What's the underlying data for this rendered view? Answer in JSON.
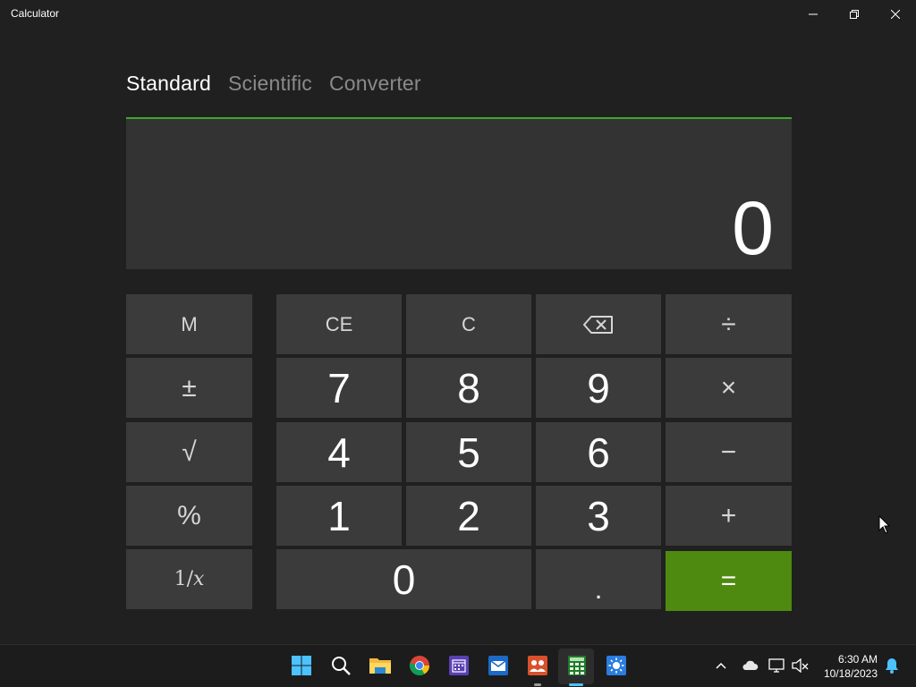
{
  "window": {
    "title": "Calculator"
  },
  "tabs": [
    {
      "label": "Standard",
      "active": true
    },
    {
      "label": "Scientific",
      "active": false
    },
    {
      "label": "Converter",
      "active": false
    }
  ],
  "display": {
    "value": "0"
  },
  "keypad": {
    "memory": "M",
    "plus_minus": "±",
    "sqrt": "√",
    "percent": "%",
    "reciprocal": "1/𝑥",
    "ce": "CE",
    "c": "C",
    "backspace_icon": "backspace-icon",
    "divide": "÷",
    "multiply": "×",
    "minus": "−",
    "plus": "+",
    "equals": "=",
    "decimal": ".",
    "d7": "7",
    "d8": "8",
    "d9": "9",
    "d4": "4",
    "d5": "5",
    "d6": "6",
    "d1": "1",
    "d2": "2",
    "d3": "3",
    "d0": "0"
  },
  "taskbar": {
    "apps": [
      "start-icon",
      "search-icon",
      "file-explorer-icon",
      "chrome-icon",
      "calendar-icon",
      "mail-icon",
      "people-icon",
      "calculator-icon",
      "weather-icon"
    ],
    "time": "6:30 AM",
    "date": "10/18/2023"
  },
  "colors": {
    "accent": "#3aa92a",
    "equals": "#4f8a10",
    "background": "#202020",
    "key": "#3b3b3b"
  }
}
